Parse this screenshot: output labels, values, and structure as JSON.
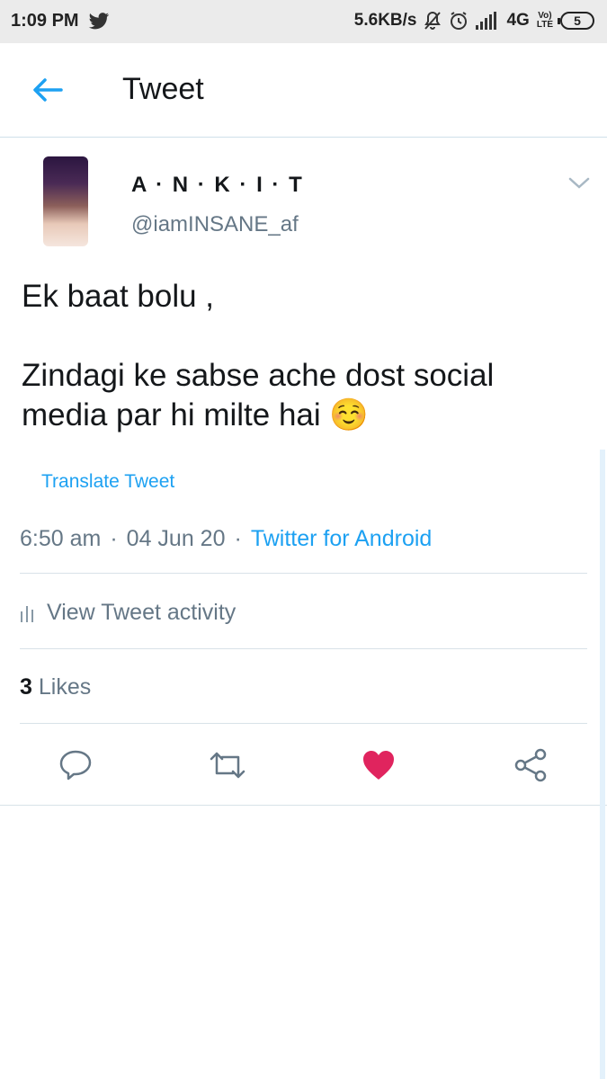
{
  "status_bar": {
    "time": "1:09 PM",
    "speed": "5.6KB/s",
    "network": "4G",
    "volte_line1": "Vo)",
    "volte_line2": "LTE",
    "battery": "5"
  },
  "header": {
    "title": "Tweet"
  },
  "author": {
    "display_name": "A · N · K · I · T",
    "handle": "@iamINSANE_af"
  },
  "tweet": {
    "text": "Ek baat bolu ,\n\nZindagi ke sabse ache dost social media par hi milte hai ☺️",
    "translate_label": "Translate Tweet",
    "time": "6:50 am",
    "date": "04 Jun 20",
    "source": "Twitter for Android",
    "separator": "·"
  },
  "activity": {
    "label": "View Tweet activity"
  },
  "likes": {
    "count": "3",
    "label": "Likes"
  },
  "colors": {
    "accent": "#1da1f2",
    "like": "#e0245e",
    "muted": "#657786"
  }
}
